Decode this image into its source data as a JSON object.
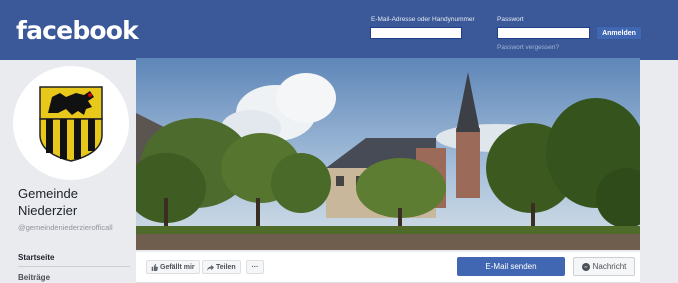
{
  "header": {
    "logo_text": "facebook",
    "email_label": "E-Mail-Adresse oder Handynummer",
    "password_label": "Passwort",
    "email_value": "",
    "password_value": "",
    "login_button": "Anmelden",
    "forgot_password": "Passwort vergessen?"
  },
  "profile": {
    "name": "Gemeinde Niederzier",
    "handle": "@gemeindeniederzierofficall"
  },
  "sidebar": {
    "items": [
      {
        "label": "Startseite",
        "active": true
      },
      {
        "label": "Beiträge",
        "active": false
      }
    ]
  },
  "actions": {
    "like_label": "Gefällt mir",
    "share_label": "Teilen",
    "more_label": "···",
    "email_button": "E-Mail senden",
    "message_button": "Nachricht"
  },
  "colors": {
    "brand": "#3b5998",
    "button": "#4267b2",
    "page_bg": "#e9ebee"
  },
  "icons": {
    "like": "thumbs-up-icon",
    "share": "share-arrow-icon",
    "message": "messenger-icon"
  }
}
